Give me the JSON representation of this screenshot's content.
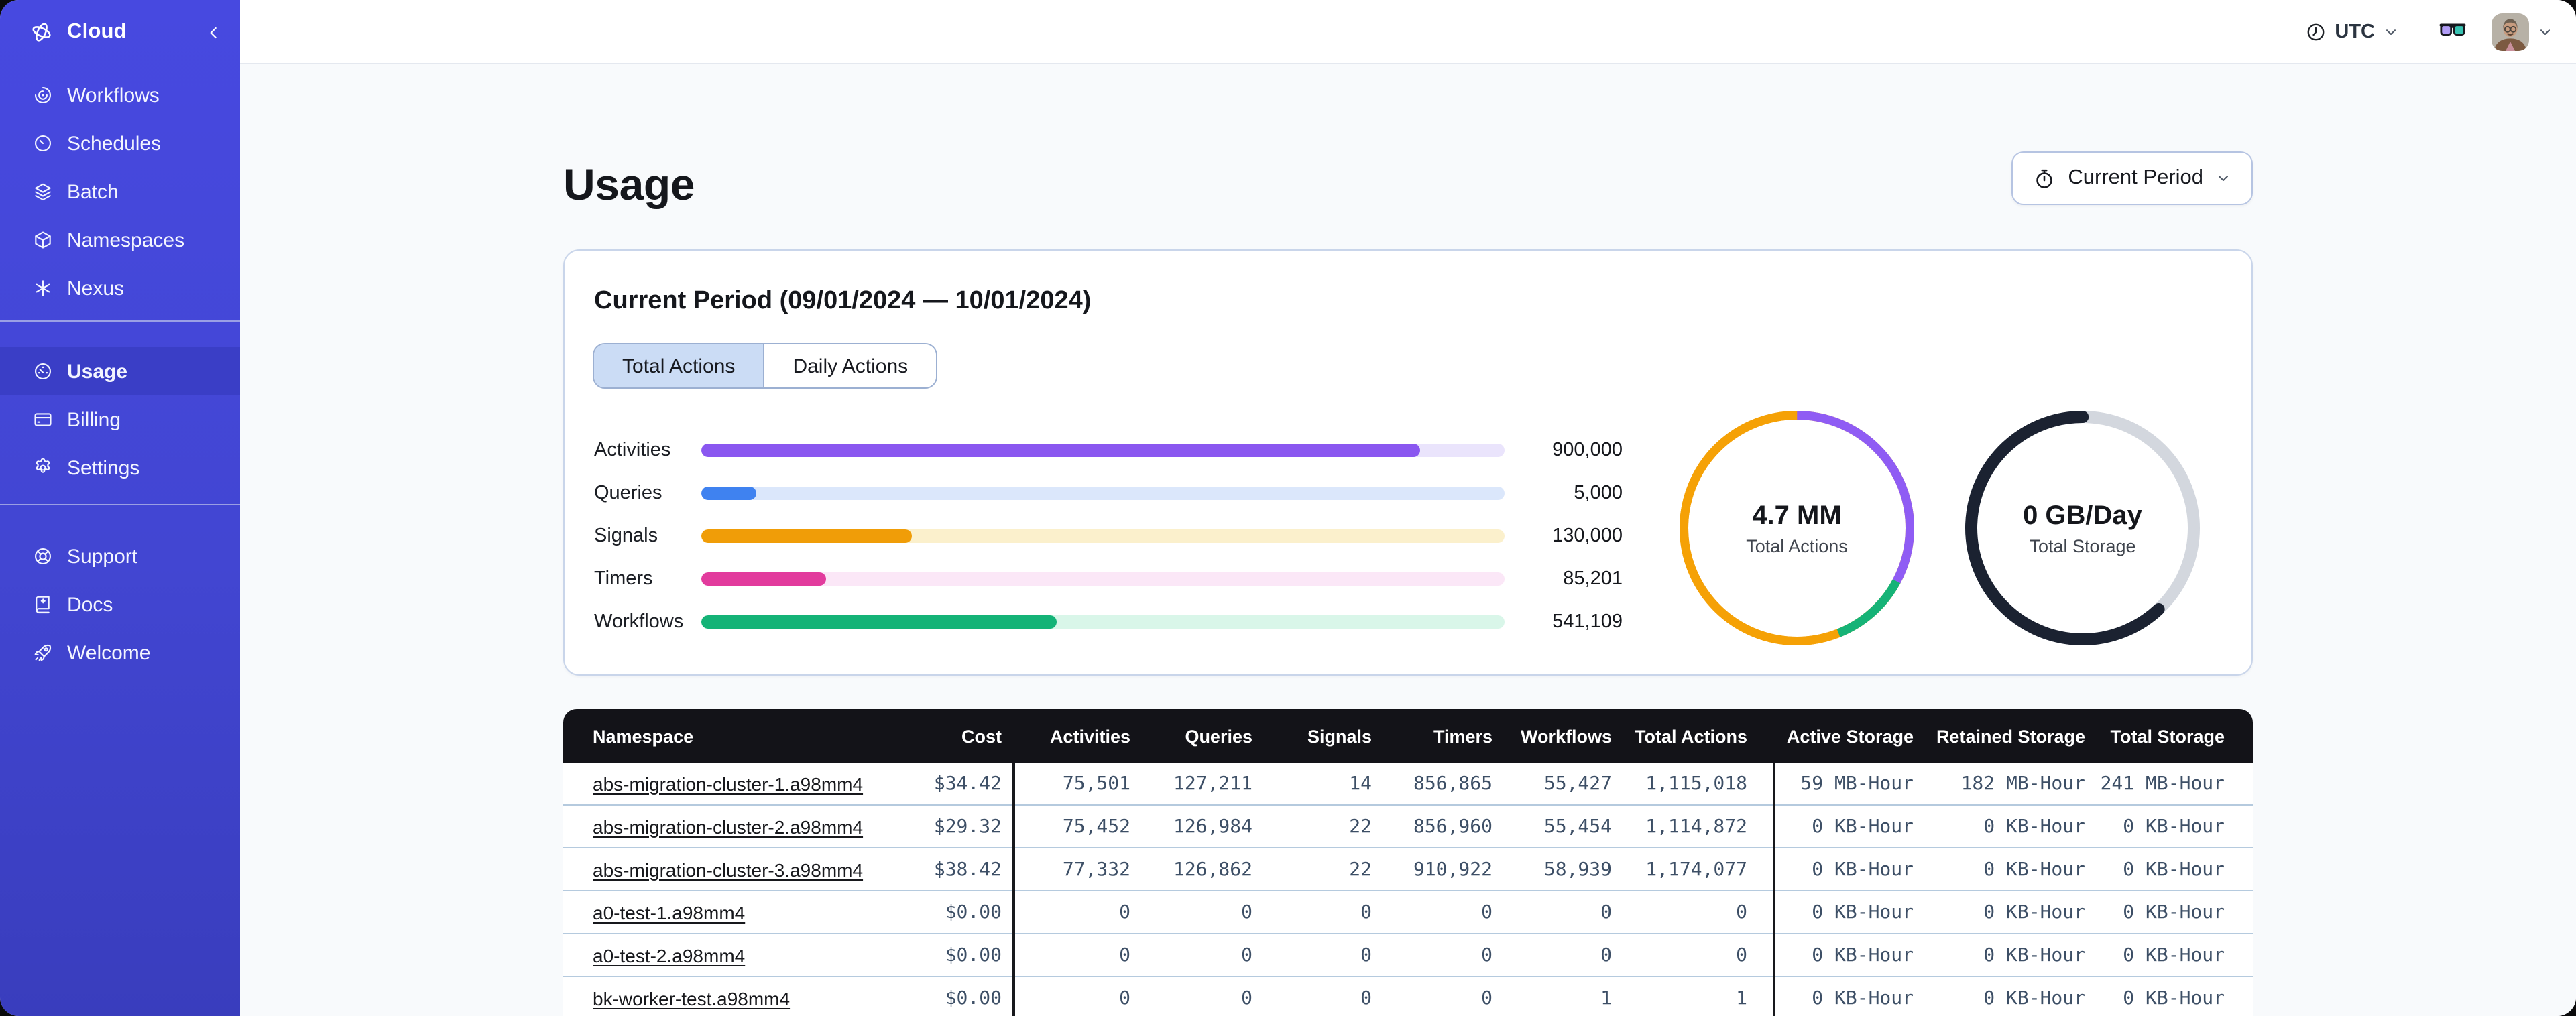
{
  "sidebar": {
    "logo": {
      "icon": "temporal-logo-icon",
      "label": "Cloud"
    },
    "collapse_icon": "chevron-left-icon",
    "sections": [
      {
        "items": [
          {
            "icon": "workflows-icon",
            "label": "Workflows",
            "selected": false
          },
          {
            "icon": "schedules-icon",
            "label": "Schedules",
            "selected": false
          },
          {
            "icon": "batch-icon",
            "label": "Batch",
            "selected": false
          },
          {
            "icon": "namespaces-icon",
            "label": "Namespaces",
            "selected": false
          },
          {
            "icon": "nexus-icon",
            "label": "Nexus",
            "selected": false
          }
        ]
      },
      {
        "items": [
          {
            "icon": "usage-icon",
            "label": "Usage",
            "selected": true
          },
          {
            "icon": "billing-icon",
            "label": "Billing",
            "selected": false
          },
          {
            "icon": "settings-icon",
            "label": "Settings",
            "selected": false
          }
        ]
      },
      {
        "items": [
          {
            "icon": "support-icon",
            "label": "Support",
            "selected": false
          },
          {
            "icon": "docs-icon",
            "label": "Docs",
            "selected": false
          },
          {
            "icon": "welcome-icon",
            "label": "Welcome",
            "selected": false
          }
        ]
      }
    ]
  },
  "topbar": {
    "timezone": "UTC"
  },
  "page": {
    "title": "Usage"
  },
  "period_button": {
    "icon": "stopwatch-icon",
    "label": "Current Period"
  },
  "card": {
    "title": "Current Period (09/01/2024 — 10/01/2024)",
    "tabs": [
      {
        "label": "Total Actions",
        "selected": true
      },
      {
        "label": "Daily Actions",
        "selected": false
      }
    ]
  },
  "chart_data": [
    {
      "type": "bar",
      "orientation": "horizontal",
      "title": "",
      "categories": [
        "Activities",
        "Queries",
        "Signals",
        "Timers",
        "Workflows"
      ],
      "values": [
        900000,
        5000,
        130000,
        85201,
        541109
      ],
      "value_labels": [
        "900,000",
        "5,000",
        "130,000",
        "85,201",
        "541,109"
      ],
      "fill_percents": [
        89.4,
        6.8,
        26.2,
        15.6,
        44.3
      ],
      "bar_colors": [
        "#8a57f0",
        "#3f82f0",
        "#f09d08",
        "#e23b9d",
        "#14b377"
      ],
      "track_colors": [
        "#eae4fc",
        "#dbe7fb",
        "#fbf0cc",
        "#fbe7f7",
        "#d9f6e9"
      ]
    },
    {
      "type": "pie",
      "center_title": "4.7 MM",
      "center_subtitle": "Total Actions",
      "ring_width": 6.5,
      "track_color": "#f5a106",
      "segments": [
        {
          "offset_pct": 0,
          "pct": 32.8,
          "color": "#8f5cf4"
        },
        {
          "offset_pct": 32.8,
          "pct": 11.2,
          "color": "#16b377"
        },
        {
          "offset_pct": 44,
          "pct": 56,
          "color": "#f5a106"
        }
      ]
    },
    {
      "type": "pie",
      "center_title": "0 GB/Day",
      "center_subtitle": "Total Storage",
      "ring_width": 9,
      "track_color": "#d3d7de",
      "segments": [
        {
          "offset_pct": 38,
          "pct": 62,
          "color": "#1b2231",
          "cap": "round"
        }
      ]
    }
  ],
  "table": {
    "columns": [
      "Namespace",
      "Cost",
      "Activities",
      "Queries",
      "Signals",
      "Timers",
      "Workflows",
      "Total Actions",
      "Active Storage",
      "Retained Storage",
      "Total Storage"
    ],
    "rows": [
      {
        "namespace": "abs-migration-cluster-1.a98mm4",
        "cost": "$34.42",
        "activities": "75,501",
        "queries": "127,211",
        "signals": "14",
        "timers": "856,865",
        "workflows": "55,427",
        "total_actions": "1,115,018",
        "active_storage": "59 MB-Hour",
        "retained_storage": "182 MB-Hour",
        "total_storage": "241 MB-Hour"
      },
      {
        "namespace": "abs-migration-cluster-2.a98mm4",
        "cost": "$29.32",
        "activities": "75,452",
        "queries": "126,984",
        "signals": "22",
        "timers": "856,960",
        "workflows": "55,454",
        "total_actions": "1,114,872",
        "active_storage": "0 KB-Hour",
        "retained_storage": "0 KB-Hour",
        "total_storage": "0 KB-Hour"
      },
      {
        "namespace": "abs-migration-cluster-3.a98mm4",
        "cost": "$38.42",
        "activities": "77,332",
        "queries": "126,862",
        "signals": "22",
        "timers": "910,922",
        "workflows": "58,939",
        "total_actions": "1,174,077",
        "active_storage": "0 KB-Hour",
        "retained_storage": "0 KB-Hour",
        "total_storage": "0 KB-Hour"
      },
      {
        "namespace": "a0-test-1.a98mm4",
        "cost": "$0.00",
        "activities": "0",
        "queries": "0",
        "signals": "0",
        "timers": "0",
        "workflows": "0",
        "total_actions": "0",
        "active_storage": "0 KB-Hour",
        "retained_storage": "0 KB-Hour",
        "total_storage": "0 KB-Hour"
      },
      {
        "namespace": "a0-test-2.a98mm4",
        "cost": "$0.00",
        "activities": "0",
        "queries": "0",
        "signals": "0",
        "timers": "0",
        "workflows": "0",
        "total_actions": "0",
        "active_storage": "0 KB-Hour",
        "retained_storage": "0 KB-Hour",
        "total_storage": "0 KB-Hour"
      },
      {
        "namespace": "bk-worker-test.a98mm4",
        "cost": "$0.00",
        "activities": "0",
        "queries": "0",
        "signals": "0",
        "timers": "0",
        "workflows": "1",
        "total_actions": "1",
        "active_storage": "0 KB-Hour",
        "retained_storage": "0 KB-Hour",
        "total_storage": "0 KB-Hour"
      }
    ]
  },
  "colors": {
    "sidebar_top": "#4749e0",
    "sidebar_bottom": "#393dbd",
    "selected_item_bg": "#3a3ec6",
    "table_header_bg": "#131318",
    "row_divider": "#b5cade",
    "numeric_text": "#3d4f66",
    "card_border": "#c9d5ea",
    "page_bg": "#f8fafc"
  }
}
